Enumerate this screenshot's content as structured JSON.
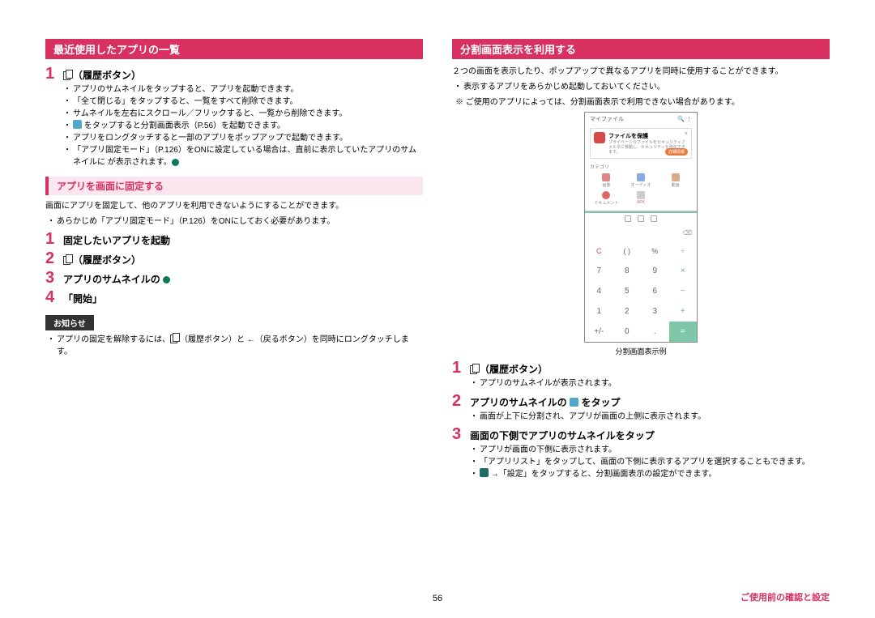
{
  "left": {
    "heading_major": "最近使用したアプリの一覧",
    "step1": {
      "title": "（履歴ボタン）",
      "bullets": [
        "アプリのサムネイルをタップすると、アプリを起動できます。",
        "「全て閉じる」をタップすると、一覧をすべて削除できます。",
        "サムネイルを左右にスクロール／フリックすると、一覧から削除できます。",
        " をタップすると分割画面表示（P.56）を起動できます。",
        "アプリをロングタッチすると一部のアプリをポップアップで起動できます。",
        "「アプリ固定モード」（P.126）をONに設定している場合は、直前に表示していたアプリのサムネイルに  が表示されます。"
      ]
    },
    "heading_minor": "アプリを画面に固定する",
    "pin_intro": "画面にアプリを固定して、他のアプリを利用できないようにすることができます。",
    "pin_note": "あらかじめ「アプリ固定モード」（P.126）をONにしておく必要があります。",
    "steps": {
      "s1": "固定したいアプリを起動",
      "s2": "（履歴ボタン）",
      "s3": "アプリのサムネイルの ",
      "s4": "「開始」"
    },
    "notice_label": "お知らせ",
    "notice_text": "アプリの固定を解除するには、（履歴ボタン）と （戻るボタン）を同時にロングタッチします。"
  },
  "right": {
    "heading_major": "分割画面表示を利用する",
    "intro": "２つの画面を表示したり、ポップアップで異なるアプリを同時に使用することができます。",
    "bullets_top": [
      "表示するアプリをあらかじめ起動しておいてください。",
      "※ ご使用のアプリによっては、分割画面表示で利用できない場合があります。"
    ],
    "phone": {
      "title": "マイファイル",
      "card_title": "ファイルを保護",
      "card_text": "プライベートなファイルをセキュリティフォルダに移動し、セキュリティを強化できます。",
      "card_btn": "詳細情報",
      "cat_label": "カテゴリ",
      "cats1": [
        "画像",
        "オーディオ",
        "動画"
      ],
      "cats2": [
        "ドキュメント",
        "APK"
      ],
      "calc_rows": [
        [
          "C",
          "( )",
          "%",
          "÷"
        ],
        [
          "7",
          "8",
          "9",
          "×"
        ],
        [
          "4",
          "5",
          "6",
          "−"
        ],
        [
          "1",
          "2",
          "3",
          "+"
        ],
        [
          "+/-",
          "0",
          ".",
          "="
        ]
      ],
      "caption": "分割画面表示例"
    },
    "step1": {
      "title": "（履歴ボタン）",
      "b1": "アプリのサムネイルが表示されます。"
    },
    "step2": {
      "title_pre": "アプリのサムネイルの ",
      "title_post": " をタップ",
      "b1": "画面が上下に分割され、アプリが画面の上側に表示されます。"
    },
    "step3": {
      "title": "画面の下側でアプリのサムネイルをタップ",
      "b1": "アプリが画面の下側に表示されます。",
      "b2": "「アプリリスト」をタップして、画面の下側に表示するアプリを選択することもできます。",
      "b3": " →「設定」をタップすると、分割画面表示の設定ができます。"
    }
  },
  "page_number": "56",
  "footer": "ご使用前の確認と設定"
}
